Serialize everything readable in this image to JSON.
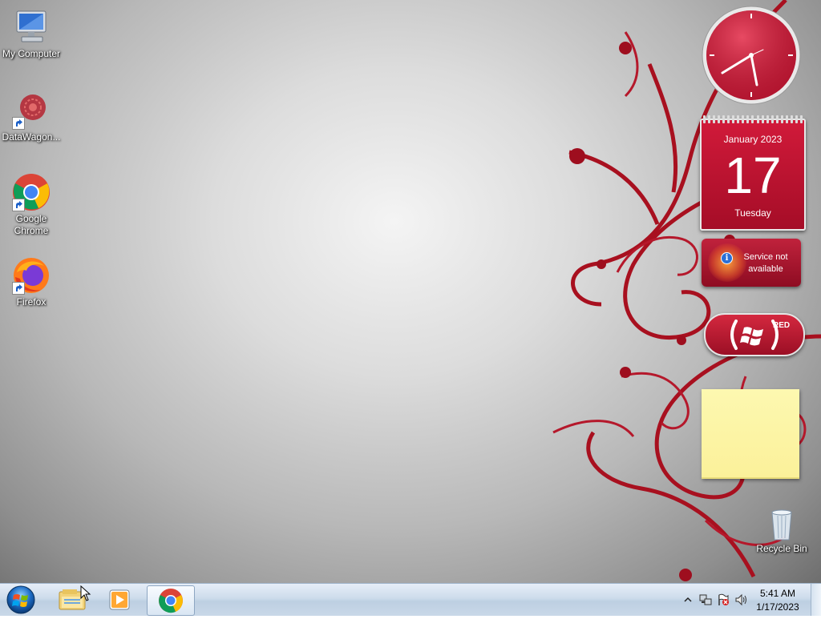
{
  "desktop": {
    "icons": [
      {
        "label": "My Computer",
        "icon": "computer-icon"
      },
      {
        "label": "DataWagon...",
        "icon": "datawagon-icon"
      },
      {
        "label": "Google Chrome",
        "icon": "chrome-icon"
      },
      {
        "label": "Firefox",
        "icon": "firefox-icon"
      },
      {
        "label": "Recycle Bin",
        "icon": "recycle-bin-icon"
      }
    ]
  },
  "gadgets": {
    "calendar": {
      "month": "January 2023",
      "day": "17",
      "weekday": "Tuesday"
    },
    "weather": {
      "message": "Service not available"
    },
    "red": {
      "label": "RED"
    }
  },
  "taskbar": {
    "pinned": [
      {
        "icon": "windows-explorer-icon"
      },
      {
        "icon": "media-player-icon"
      },
      {
        "icon": "chrome-icon",
        "active": true
      }
    ],
    "tray": {
      "time": "5:41 AM",
      "date": "1/17/2023",
      "icons": [
        "show-hidden-icons-chevron",
        "network-icon",
        "action-center-flag-icon",
        "volume-icon"
      ]
    }
  },
  "colors": {
    "gadget_red": "#c0223c",
    "sticky_yellow": "#fbf19a",
    "taskbar": "#cddceb"
  }
}
